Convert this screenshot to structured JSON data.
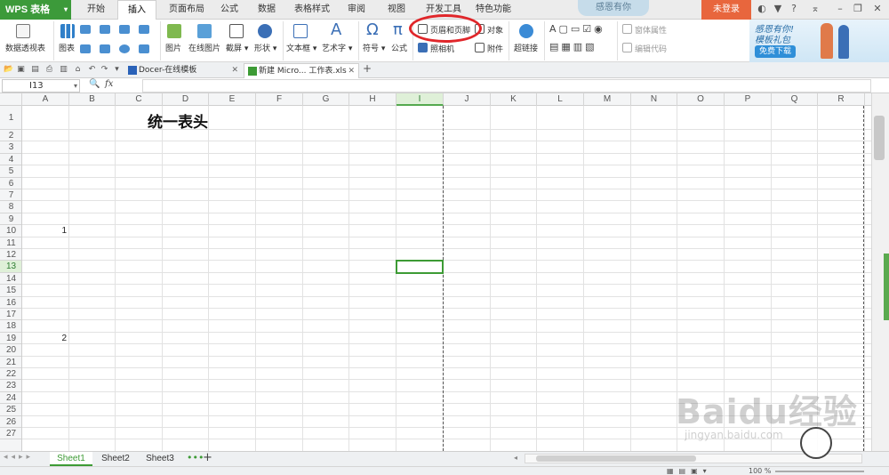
{
  "app": {
    "name": "WPS 表格"
  },
  "tabs": [
    {
      "label": "开始",
      "active": false
    },
    {
      "label": "插入",
      "active": true
    },
    {
      "label": "页面布局",
      "active": false
    },
    {
      "label": "公式",
      "active": false
    },
    {
      "label": "数据",
      "active": false
    },
    {
      "label": "表格样式",
      "active": false
    },
    {
      "label": "审阅",
      "active": false
    },
    {
      "label": "视图",
      "active": false
    },
    {
      "label": "开发工具",
      "active": false
    },
    {
      "label": "特色功能",
      "active": false
    }
  ],
  "promo_label": "感恩有你",
  "login_label": "未登录",
  "window_controls": [
    "skin-icon",
    "shirt-icon",
    "help-icon",
    "ribbon-collapse-icon",
    "minimize-icon",
    "restore-icon",
    "close-icon"
  ],
  "ribbon": {
    "pivot": "数据透视表",
    "chart": "图表",
    "picture": "图片",
    "online_picture": "在线图片",
    "screenshot": "截屏",
    "shapes": "形状",
    "textbox": "文本框",
    "wordart": "艺术字",
    "symbol": "符号",
    "formula": "公式",
    "header_footer": "页眉和页脚",
    "object": "对象",
    "camera": "照相机",
    "attachment": "附件",
    "hyperlink": "超链接",
    "form_props": "窗体属性",
    "edit_code": "编辑代码"
  },
  "banner": {
    "line1": "感恩有你!",
    "line2": "模板礼包",
    "download": "免费下载"
  },
  "doc_tabs": [
    {
      "label": "Docer-在线模板",
      "active": false
    },
    {
      "label": "新建 Micro... 工作表.xls",
      "active": true
    }
  ],
  "formula_bar": {
    "cell_ref": "I13",
    "fx": "fx",
    "zoom_icon": "🔍"
  },
  "columns": [
    "A",
    "B",
    "C",
    "D",
    "E",
    "F",
    "G",
    "H",
    "I",
    "J",
    "K",
    "L",
    "M",
    "N",
    "O",
    "P",
    "Q",
    "R"
  ],
  "selected_column": "I",
  "rows": [
    "1",
    "2",
    "3",
    "4",
    "5",
    "6",
    "7",
    "8",
    "9",
    "10",
    "11",
    "12",
    "13",
    "14",
    "15",
    "16",
    "17",
    "18",
    "19",
    "20",
    "21",
    "22",
    "23",
    "24",
    "25",
    "26",
    "27"
  ],
  "selected_row": "13",
  "cells": {
    "C1": "统一表头",
    "A10": "1",
    "A19": "2"
  },
  "sheets": [
    {
      "label": "Sheet1",
      "active": true
    },
    {
      "label": "Sheet2",
      "active": false
    },
    {
      "label": "Sheet3",
      "active": false
    }
  ],
  "status": {
    "zoom": "100 %"
  },
  "watermark": {
    "brand": "Baidu经验",
    "url": "jingyan.baidu.com"
  },
  "colors": {
    "accent": "#3d9b35",
    "login": "#e8663d",
    "annotation": "#e0262a"
  }
}
